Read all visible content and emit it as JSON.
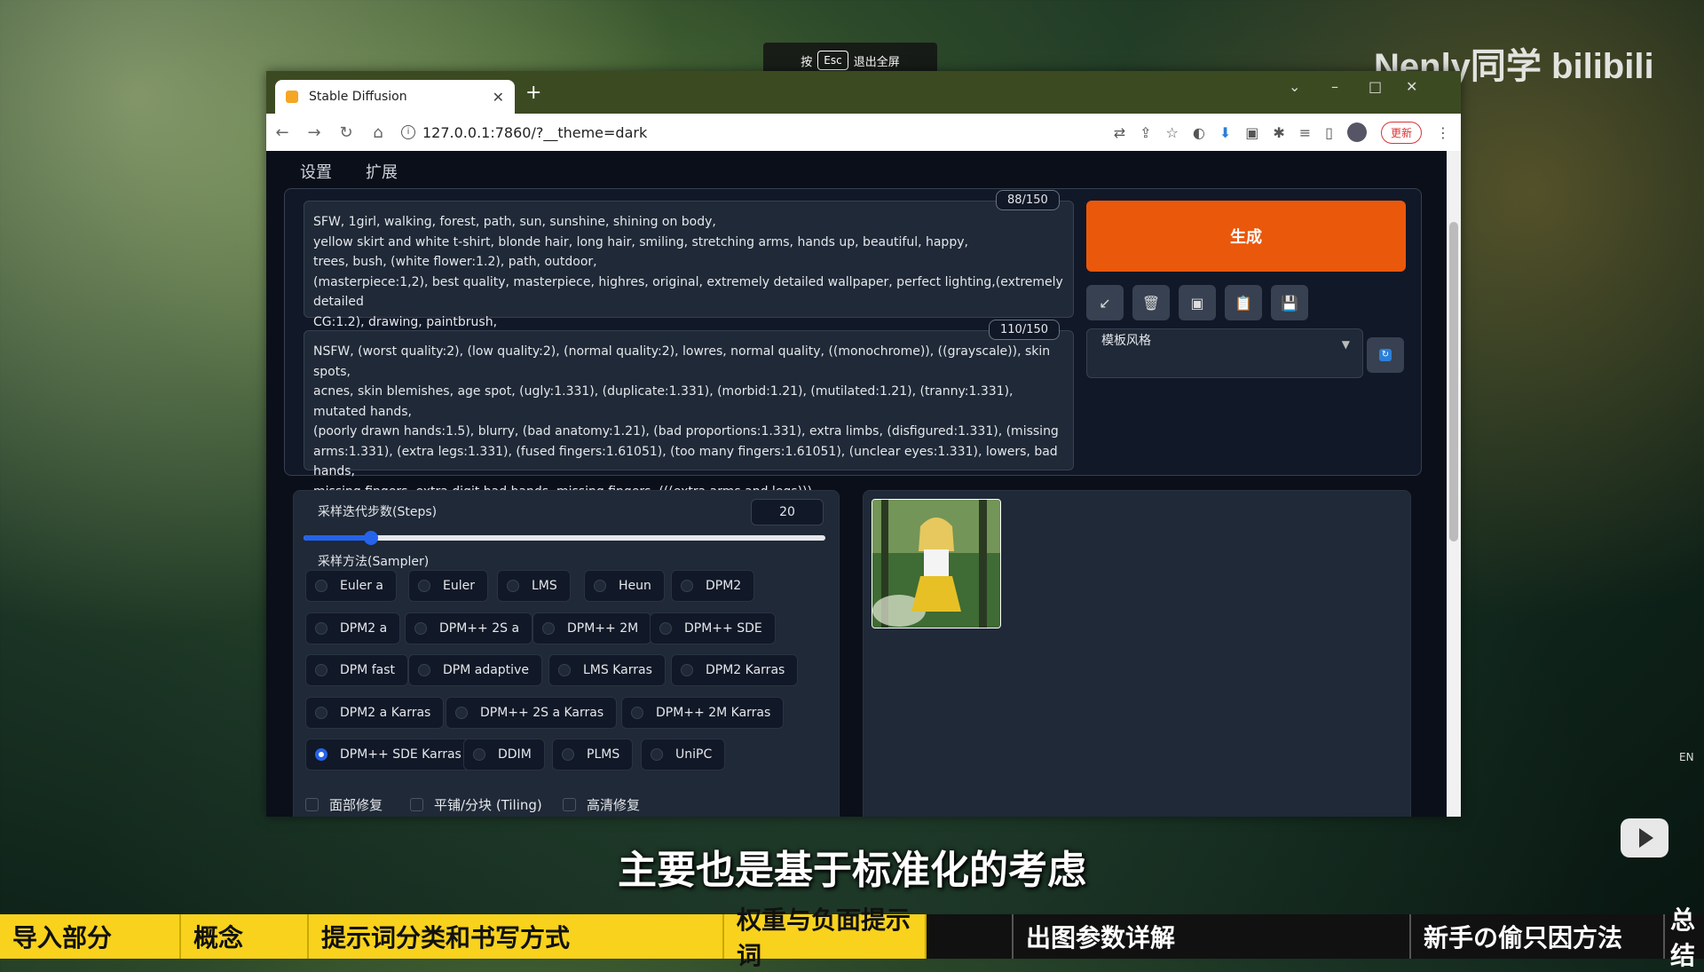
{
  "overlay": {
    "esc_prefix": "按",
    "esc_key": "Esc",
    "esc_suffix": "退出全屏",
    "watermark": "Nenly同学 bilibili"
  },
  "browser": {
    "tab_title": "Stable Diffusion",
    "url": "127.0.0.1:7860/?__theme=dark",
    "update_label": "更新"
  },
  "app": {
    "nav": [
      "设置",
      "扩展"
    ],
    "positive_prompt": "SFW, 1girl, walking, forest, path, sun, sunshine, shining on body,\nyellow skirt and white t-shirt, blonde hair, long hair, smiling, stretching arms, hands up, beautiful, happy,\ntrees, bush, (white flower:1.2), path, outdoor,\n(masterpiece:1,2), best quality, masterpiece, highres, original, extremely detailed wallpaper, perfect lighting,(extremely detailed\nCG:1.2), drawing, paintbrush,",
    "positive_counter": "88/150",
    "negative_prompt": "NSFW, (worst quality:2), (low quality:2), (normal quality:2), lowres, normal quality, ((monochrome)), ((grayscale)), skin spots,\nacnes, skin blemishes, age spot, (ugly:1.331), (duplicate:1.331), (morbid:1.21), (mutilated:1.21), (tranny:1.331), mutated hands,\n(poorly drawn hands:1.5), blurry, (bad anatomy:1.21), (bad proportions:1.331), extra limbs, (disfigured:1.331), (missing\narms:1.331), (extra legs:1.331), (fused fingers:1.61051), (too many fingers:1.61051), (unclear eyes:1.331), lowers, bad hands,\nmissing fingers, extra digit,bad hands, missing fingers, (((extra arms and legs))),",
    "negative_counter": "110/150",
    "generate_label": "生成",
    "style_label": "模板风格",
    "steps_label": "采样迭代步数(Steps)",
    "steps_value": "20",
    "steps_fraction": 0.13,
    "sampler_label": "采样方法(Sampler)",
    "samplers": [
      "Euler a",
      "Euler",
      "LMS",
      "Heun",
      "DPM2",
      "DPM2 a",
      "DPM++ 2S a",
      "DPM++ 2M",
      "DPM++ SDE",
      "DPM fast",
      "DPM adaptive",
      "LMS Karras",
      "DPM2 Karras",
      "DPM2 a Karras",
      "DPM++ 2S a Karras",
      "DPM++ 2M Karras",
      "DPM++ SDE Karras",
      "DDIM",
      "PLMS",
      "UniPC"
    ],
    "selected_sampler": "DPM++ SDE Karras",
    "checkboxes": [
      "面部修复",
      "平铺/分块 (Tiling)",
      "高清修复"
    ]
  },
  "subtitle": "主要也是基于标准化的考虑",
  "chapters": [
    "导入部分",
    "概念",
    "提示词分类和书写方式",
    "权重与负面提示词",
    "出图参数详解",
    "新手の偷只因方法",
    "总结"
  ]
}
